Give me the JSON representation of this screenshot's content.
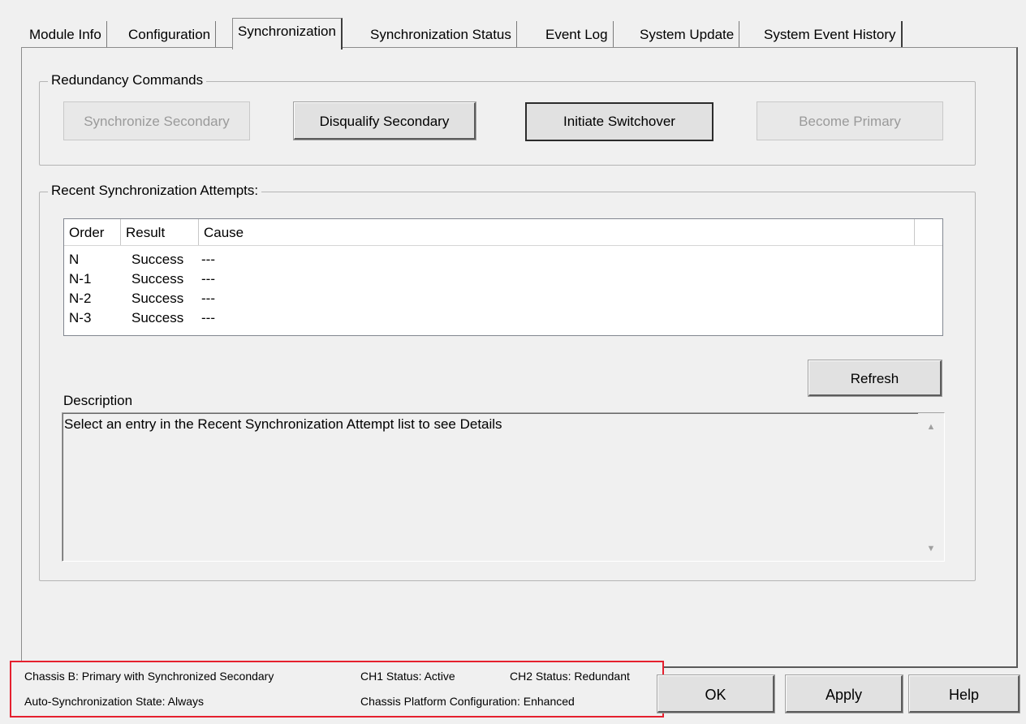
{
  "tabs": [
    {
      "label": "Module Info"
    },
    {
      "label": "Configuration"
    },
    {
      "label": "Synchronization"
    },
    {
      "label": "Synchronization Status"
    },
    {
      "label": "Event Log"
    },
    {
      "label": "System Update"
    },
    {
      "label": "System Event History"
    }
  ],
  "redundancy": {
    "title": "Redundancy Commands",
    "synchronize_secondary": "Synchronize Secondary",
    "disqualify_secondary": "Disqualify Secondary",
    "initiate_switchover": "Initiate Switchover",
    "become_primary": "Become Primary"
  },
  "attempts": {
    "title": "Recent Synchronization Attempts:",
    "columns": [
      "Order",
      "Result",
      "Cause"
    ],
    "rows": [
      {
        "order": "N",
        "result": "Success",
        "cause": "---"
      },
      {
        "order": "N-1",
        "result": "Success",
        "cause": "---"
      },
      {
        "order": "N-2",
        "result": "Success",
        "cause": "---"
      },
      {
        "order": "N-3",
        "result": "Success",
        "cause": "---"
      }
    ],
    "refresh_label": "Refresh",
    "description_label": "Description",
    "description_text": "Select an entry in the Recent Synchronization Attempt list to see Details"
  },
  "status": {
    "chassis": "Chassis B: Primary with Synchronized Secondary",
    "ch1": "CH1 Status: Active",
    "ch2": "CH2 Status: Redundant",
    "auto_sync": "Auto-Synchronization State:  Always",
    "platform": "Chassis Platform Configuration:  Enhanced"
  },
  "footer": {
    "ok": "OK",
    "apply": "Apply",
    "help": "Help"
  },
  "icons": {
    "scroll_up": "scroll-up-arrow-icon",
    "scroll_down": "scroll-down-arrow-icon"
  },
  "colors": {
    "highlight_border": "#e5202e",
    "disabled_text": "#9a9a9a"
  }
}
